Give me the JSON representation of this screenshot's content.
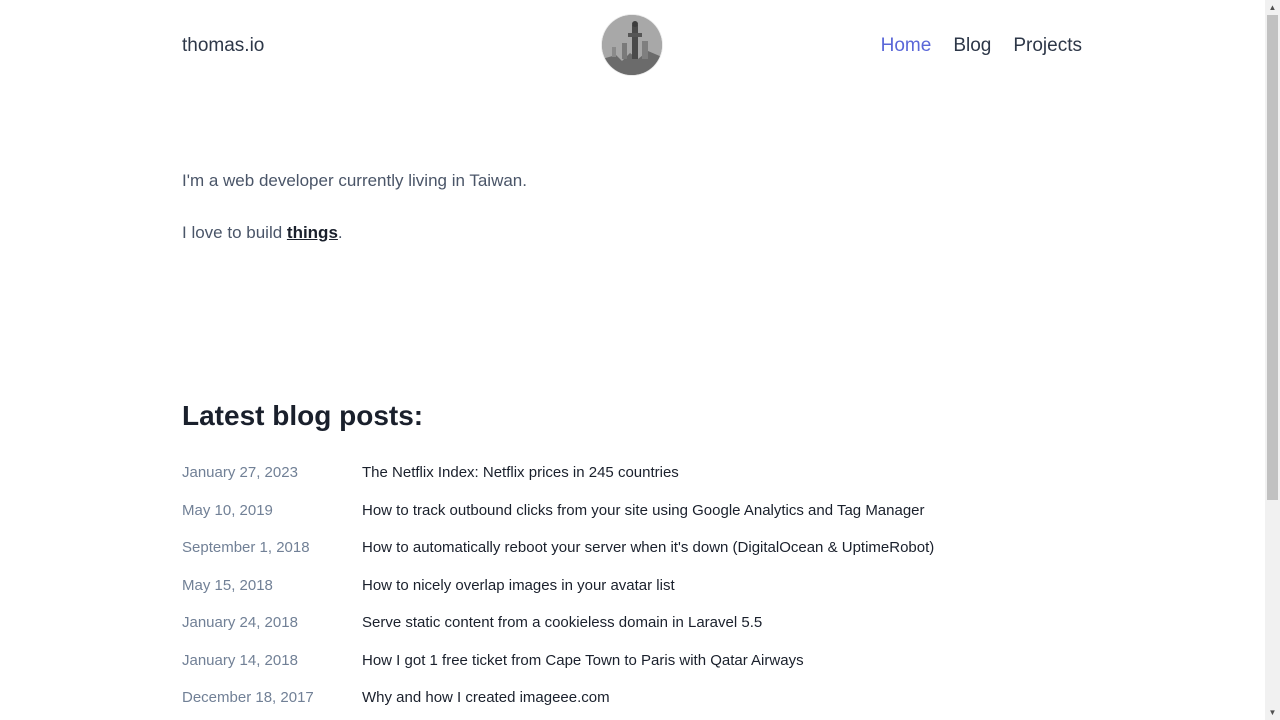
{
  "header": {
    "brand": "thomas.io",
    "nav": [
      {
        "label": "Home",
        "active": true
      },
      {
        "label": "Blog",
        "active": false
      },
      {
        "label": "Projects",
        "active": false
      }
    ]
  },
  "intro": {
    "line1": "I'm a web developer currently living in Taiwan.",
    "line2_prefix": "I love to build ",
    "line2_link": "things",
    "line2_suffix": "."
  },
  "posts": {
    "heading": "Latest blog posts:",
    "items": [
      {
        "date": "January 27, 2023",
        "title": "The Netflix Index: Netflix prices in 245 countries"
      },
      {
        "date": "May 10, 2019",
        "title": "How to track outbound clicks from your site using Google Analytics and Tag Manager"
      },
      {
        "date": "September 1, 2018",
        "title": "How to automatically reboot your server when it's down (DigitalOcean & UptimeRobot)"
      },
      {
        "date": "May 15, 2018",
        "title": "How to nicely overlap images in your avatar list"
      },
      {
        "date": "January 24, 2018",
        "title": "Serve static content from a cookieless domain in Laravel 5.5"
      },
      {
        "date": "January 14, 2018",
        "title": "How I got 1 free ticket from Cape Town to Paris with Qatar Airways"
      },
      {
        "date": "December 18, 2017",
        "title": "Why and how I created imageee.com"
      }
    ]
  },
  "colors": {
    "accent": "#5a67d8",
    "text": "#1a202c",
    "muted": "#718096"
  }
}
